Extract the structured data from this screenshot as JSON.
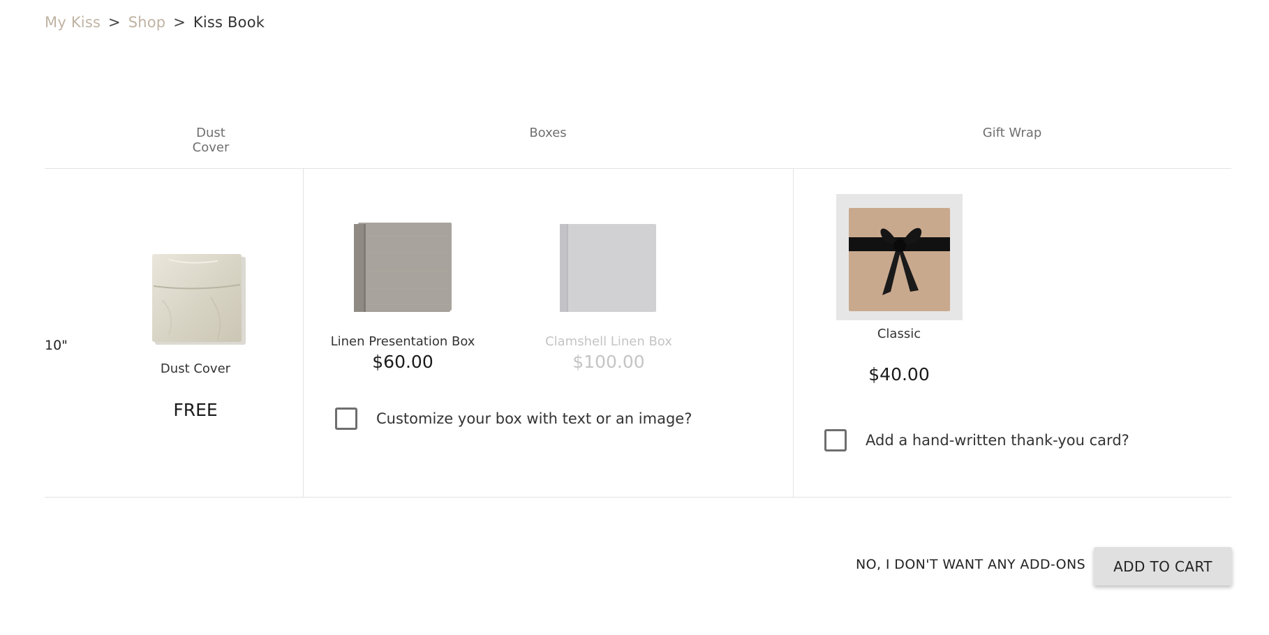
{
  "breadcrumb": {
    "items": [
      {
        "label": "My Kiss"
      },
      {
        "label": "Shop"
      }
    ],
    "separator": ">",
    "current": "Kiss Book"
  },
  "sections": {
    "dust_cover": {
      "header": "Dust Cover",
      "size_label": "10\"",
      "option": {
        "name": "Dust Cover",
        "price": "FREE",
        "icon": "dust-cover-image"
      }
    },
    "boxes": {
      "header": "Boxes",
      "options": [
        {
          "name": "Linen Presentation Box",
          "price": "$60.00",
          "icon": "linen-box-image",
          "state": "available"
        },
        {
          "name": "Clamshell Linen Box",
          "price": "$100.00",
          "icon": "clamshell-box-image",
          "state": "unavailable"
        }
      ],
      "customize_label": "Customize your box with text or an image?"
    },
    "gift_wrap": {
      "header": "Gift Wrap",
      "option": {
        "name": "Classic",
        "price": "$40.00",
        "icon": "gift-wrap-image"
      },
      "card_label": "Add a hand-written thank-you card?"
    }
  },
  "actions": {
    "no_addons": "NO, I DON'T WANT ANY ADD-ONS",
    "add_to_cart": "ADD TO CART"
  },
  "colors": {
    "breadcrumb_link": "#bfb3a3",
    "button_bg": "#e0e0e0",
    "divider": "#e3e3e3",
    "disabled_text": "#c4c4c4"
  }
}
